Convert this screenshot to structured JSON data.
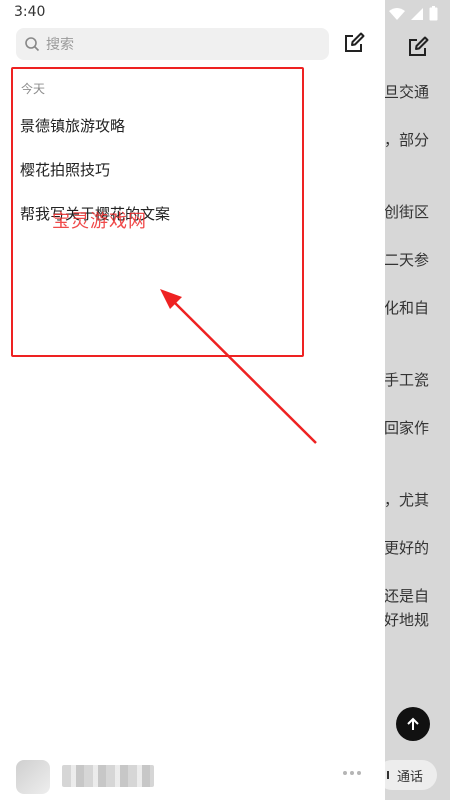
{
  "status_bar": {
    "time": "3:40"
  },
  "drawer": {
    "search_placeholder": "搜索",
    "section_label": "今天",
    "history": [
      {
        "title": "景德镇旅游攻略"
      },
      {
        "title": "樱花拍照技巧"
      },
      {
        "title": "帮我写关于樱花的文案"
      }
    ]
  },
  "background_chat": {
    "visible_fragments": [
      "旦交通",
      "，部分",
      "创街区",
      "二天参",
      "化和自",
      "手工瓷",
      "回家作",
      "，尤其",
      "更好的",
      "还是自",
      "好地规"
    ],
    "call_label": "通话"
  },
  "annotation": {
    "watermark": "宝灵游戏网",
    "highlight_color": "#ee2222"
  }
}
